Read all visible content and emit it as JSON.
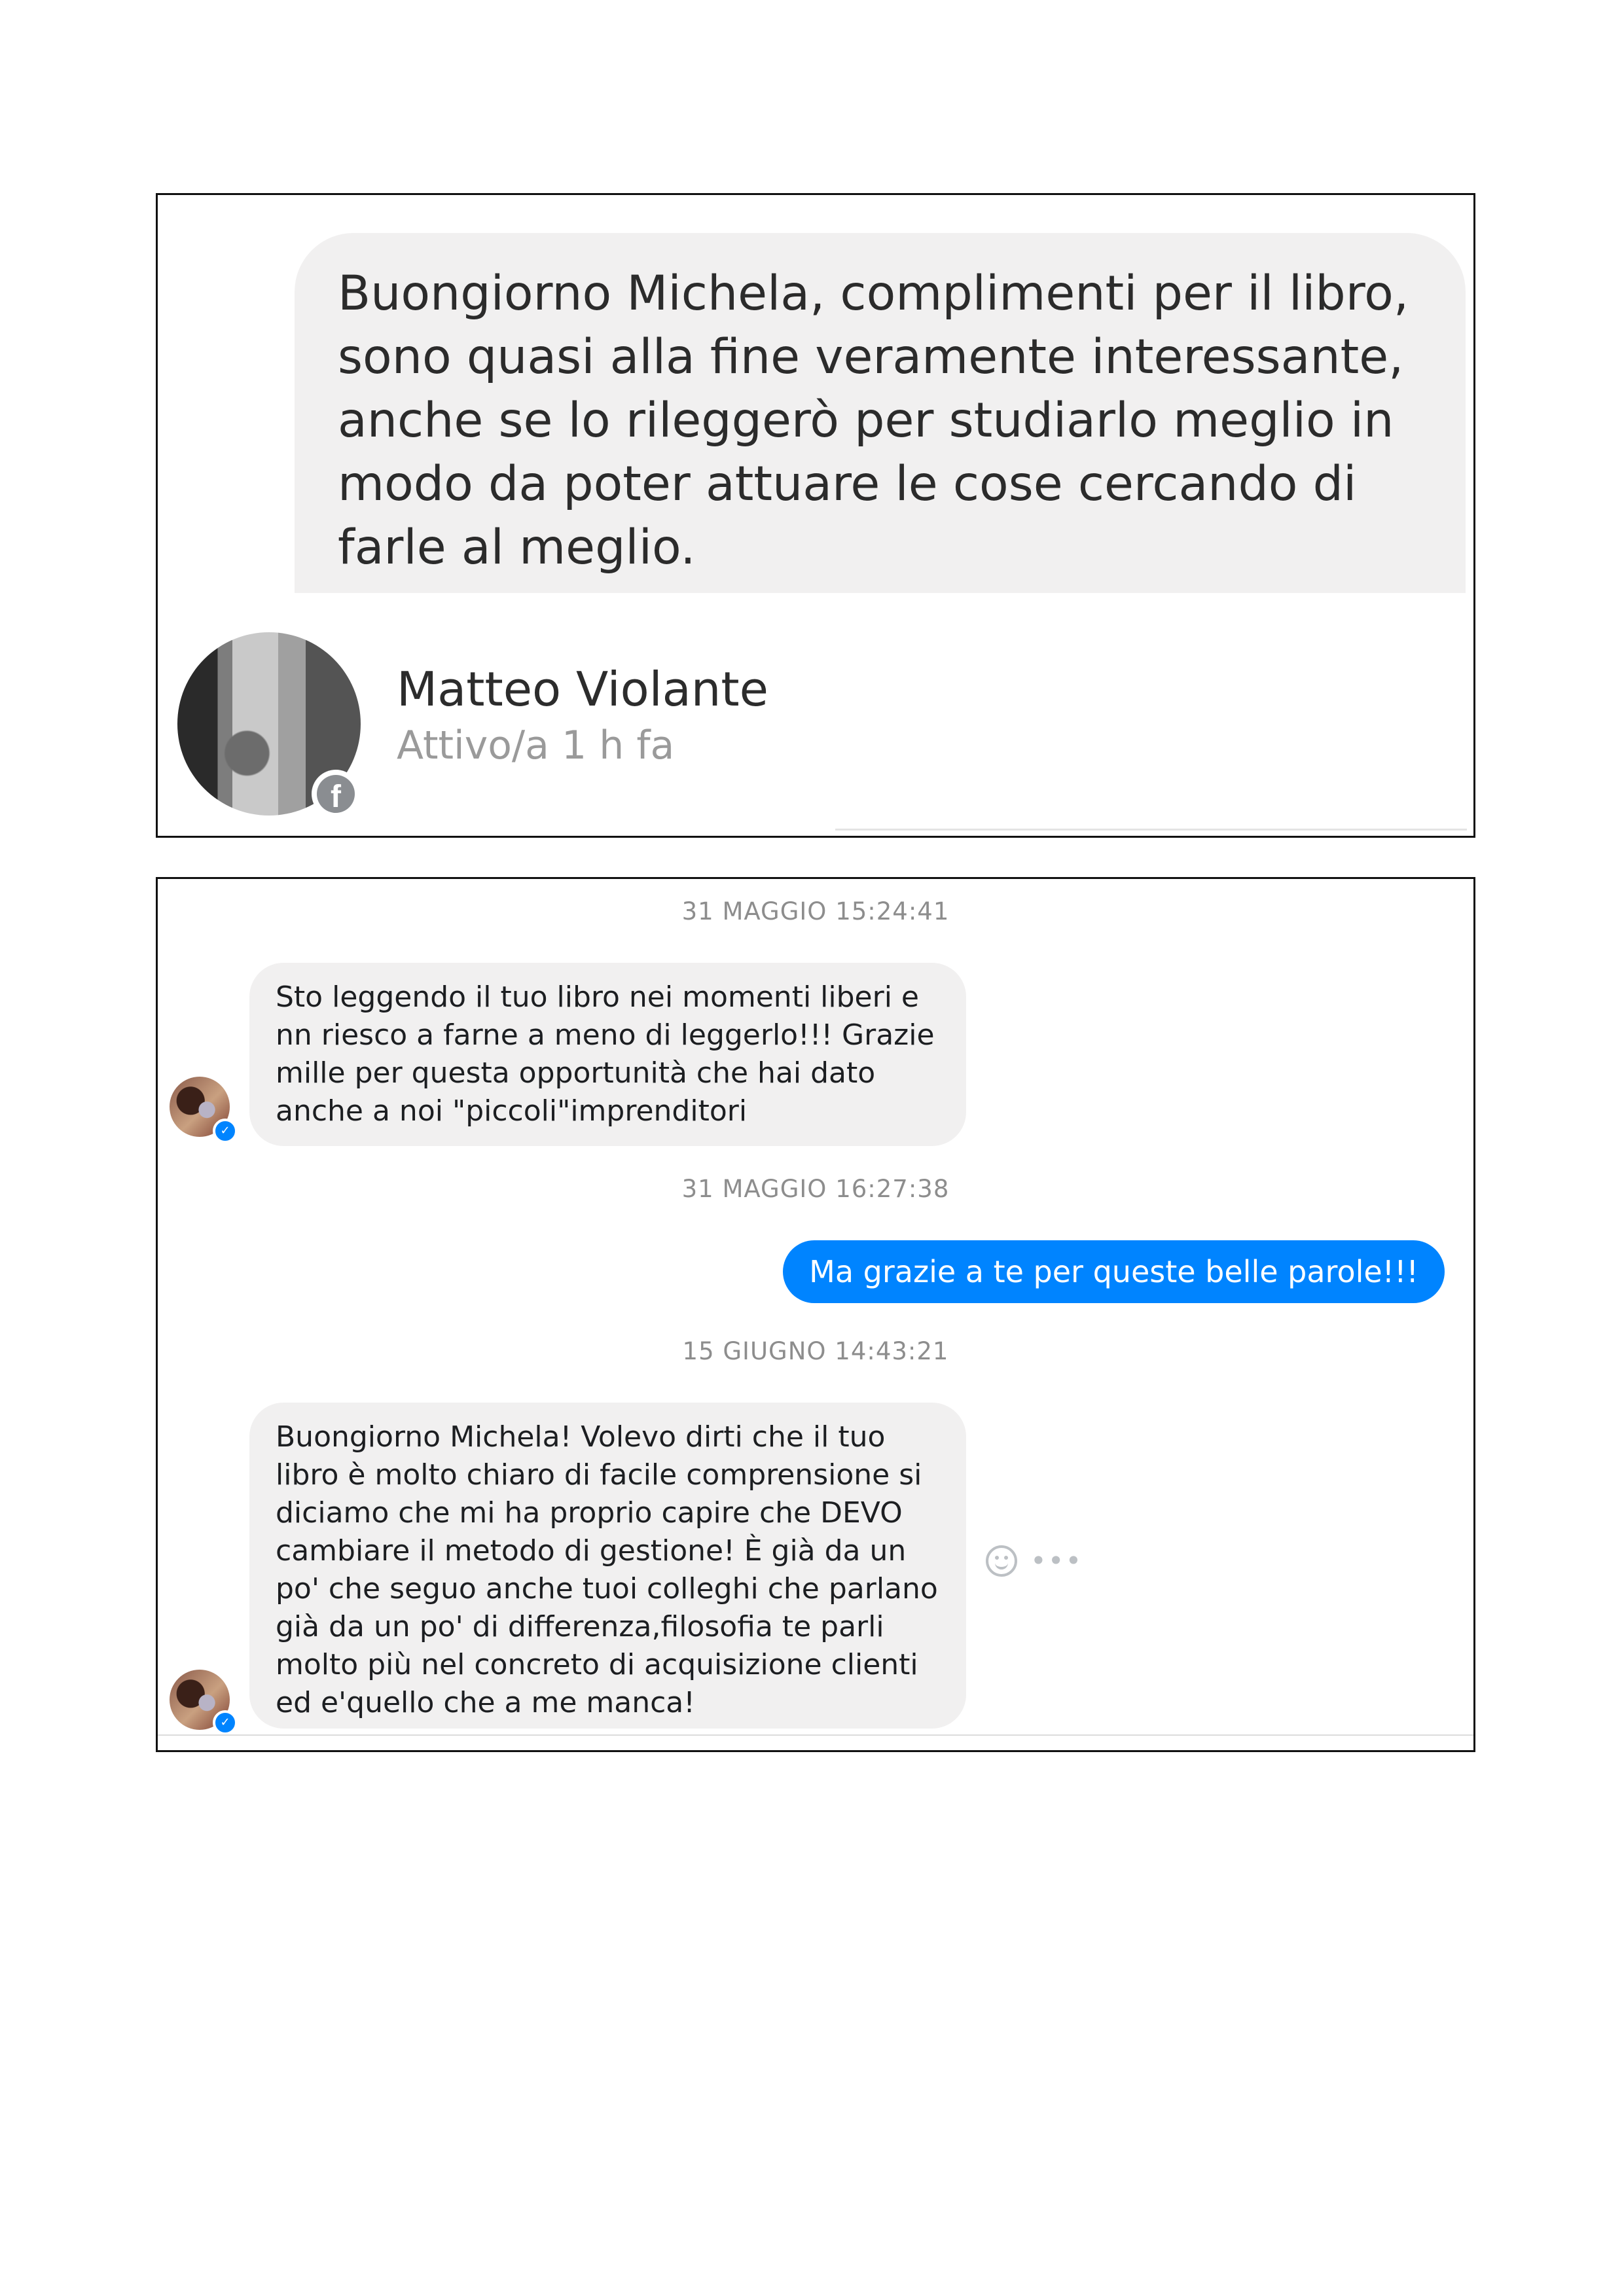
{
  "review": {
    "message": "Buongiorno Michela, complimenti per il libro, sono quasi alla fine veramente interessante, anche se lo rileggerò per studiarlo meglio in modo da poter attuare le cose cercando di farle al meglio.",
    "contact_name": "Matteo Violante",
    "contact_status": "Attivo/a 1 h fa",
    "badge_icon": "facebook-icon"
  },
  "chat": {
    "accent_color": "#0084ff",
    "timestamps": [
      "31 MAGGIO 15:24:41",
      "31 MAGGIO 16:27:38",
      "15 GIUGNO 14:43:21"
    ],
    "messages": [
      {
        "direction": "incoming",
        "text": "Sto leggendo il tuo libro nei momenti liberi e nn riesco a farne a meno di leggerlo!!! Grazie mille per questa opportunità che hai dato anche a noi \"piccoli\"imprenditori"
      },
      {
        "direction": "outgoing",
        "text": "Ma grazie a te per queste belle parole!!!"
      },
      {
        "direction": "incoming",
        "text": "Buongiorno Michela! Volevo dirti che il tuo libro è molto chiaro di facile comprensione si diciamo che mi ha proprio capire che DEVO cambiare il metodo di gestione! È già da un po' che seguo anche tuoi colleghi che parlano già da un po' di differenza,filosofia te parli molto più nel concreto di acquisizione clienti ed e'quello che a me manca!"
      }
    ],
    "reaction_icons": [
      "smile-icon",
      "more-icon"
    ]
  }
}
